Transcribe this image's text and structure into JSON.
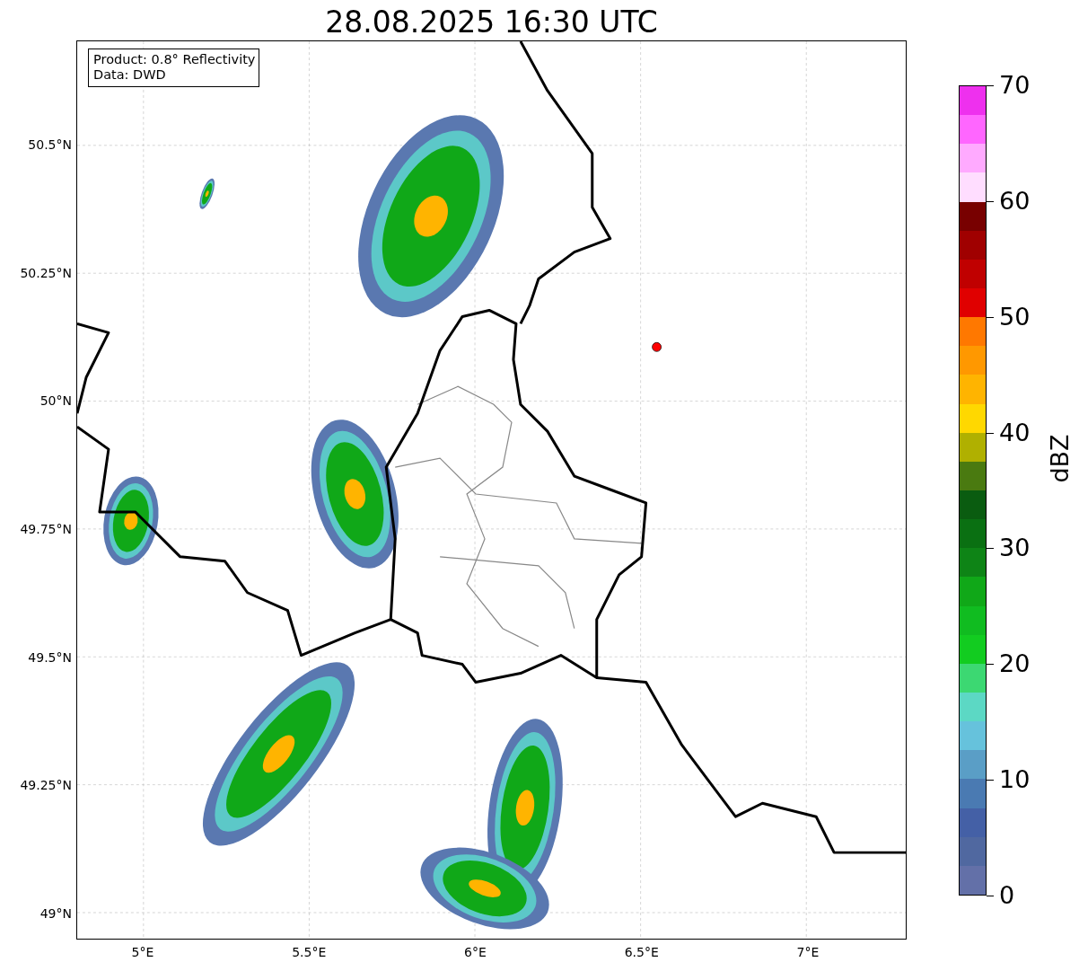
{
  "title": "28.08.2025 16:30 UTC",
  "map": {
    "legend": [
      "Product: 0.8° Reflectivity",
      "Data: DWD"
    ]
  },
  "y_ticks": [
    "50.5°N",
    "50.25°N",
    "50°N",
    "49.75°N",
    "49.5°N",
    "49.25°N",
    "49°N"
  ],
  "x_ticks": [
    "5°E",
    "5.5°E",
    "6°E",
    "6.5°E",
    "7°E"
  ],
  "colorbar": {
    "label": "dBZ",
    "ticks": [
      "70",
      "60",
      "50",
      "40",
      "30",
      "20",
      "10",
      "0"
    ],
    "bands": [
      {
        "color": "#ee30ee"
      },
      {
        "color": "#ff66ff"
      },
      {
        "color": "#ffaaff"
      },
      {
        "color": "#ffddff"
      },
      {
        "color": "#780000"
      },
      {
        "color": "#a00000"
      },
      {
        "color": "#c00000"
      },
      {
        "color": "#e00000"
      },
      {
        "color": "#ff7800"
      },
      {
        "color": "#ff9800"
      },
      {
        "color": "#ffb400"
      },
      {
        "color": "#ffd800"
      },
      {
        "color": "#b0b000"
      },
      {
        "color": "#4a7a10"
      },
      {
        "color": "#0a5c10"
      },
      {
        "color": "#0a7012"
      },
      {
        "color": "#0e8416"
      },
      {
        "color": "#10a818"
      },
      {
        "color": "#10bc20"
      },
      {
        "color": "#12cc20"
      },
      {
        "color": "#3cd872"
      },
      {
        "color": "#5cd8c4"
      },
      {
        "color": "#66c2dc"
      },
      {
        "color": "#5a9ec6"
      },
      {
        "color": "#4a7ab2"
      },
      {
        "color": "#4460a6"
      },
      {
        "color": "#5068a0"
      },
      {
        "color": "#6370a8"
      }
    ]
  }
}
